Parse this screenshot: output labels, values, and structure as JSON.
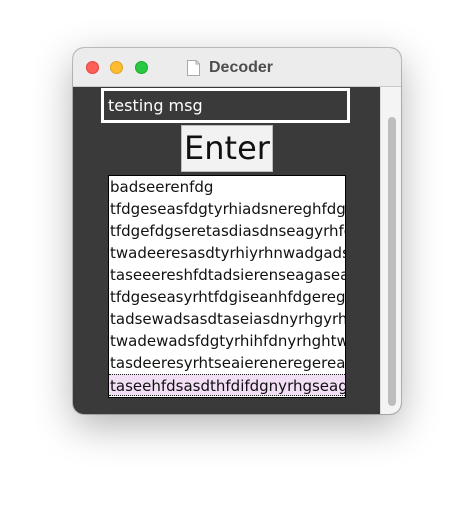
{
  "window": {
    "title": "Decoder"
  },
  "message_input": {
    "value": "testing msg"
  },
  "enter_button": {
    "label": "Enter"
  },
  "decoded_list": {
    "items": [
      "badseerenfdg",
      "tfdgeseasfdgtyrhiadsnereghfdg",
      "tfdgefdgseretasdiasdnseagyrhfdg",
      "twadeeresasdtyrhiyrhnwadgadsn",
      "taseeereshfdtadsierenseagaseadn",
      "tfdgeseasyrhtfdgiseanhfdgeregn",
      "tadsewadsasdtaseiasdnyrhgyrhfdg",
      "twadewadsfdgtyrhihfdnyrhghtwad",
      "tasdeeresyrhtseaiereneregereagn",
      "taseehfdsasdthfdifdgnyrhgseagn"
    ],
    "selected_index": 9
  }
}
